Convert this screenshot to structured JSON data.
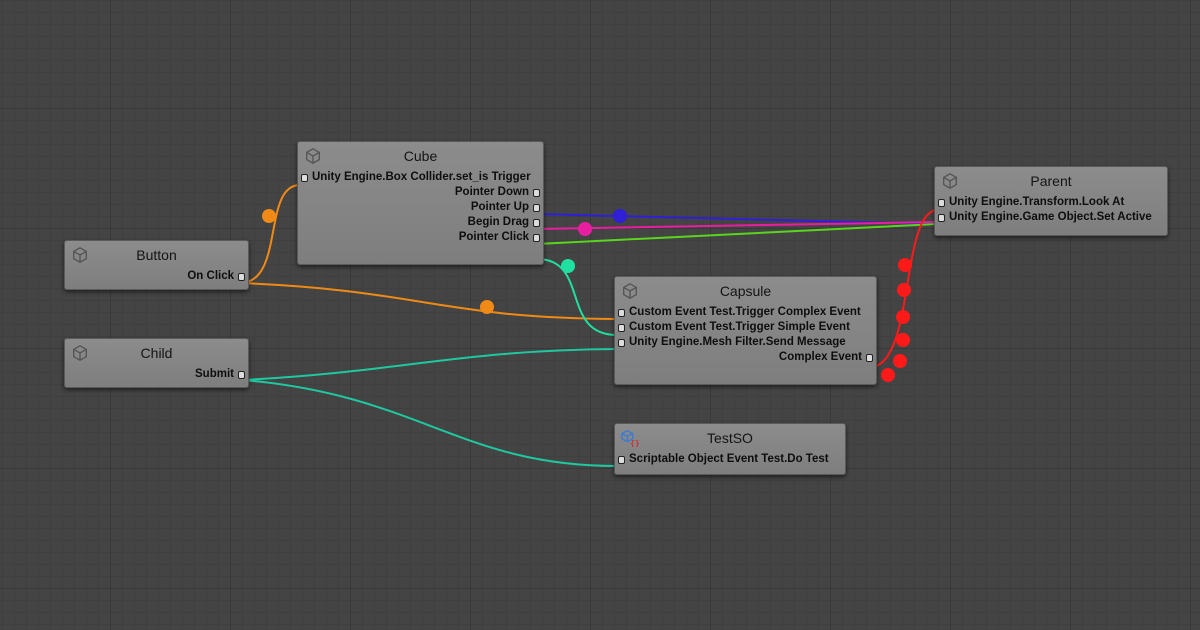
{
  "graph": {
    "nodes": {
      "cube": {
        "title": "Cube",
        "icon": "cube-icon",
        "inputs": [
          "Unity Engine.Box Collider.set_is Trigger"
        ],
        "outputs": [
          "Pointer Down",
          "Pointer Up",
          "Begin Drag",
          "Pointer Click"
        ]
      },
      "button": {
        "title": "Button",
        "icon": "cube-icon",
        "outputs": [
          "On Click"
        ]
      },
      "child": {
        "title": "Child",
        "icon": "cube-icon",
        "outputs": [
          "Submit"
        ]
      },
      "parent": {
        "title": "Parent",
        "icon": "cube-icon",
        "inputs": [
          "Unity Engine.Transform.Look At",
          "Unity Engine.Game Object.Set Active"
        ]
      },
      "capsule": {
        "title": "Capsule",
        "icon": "cube-icon",
        "inputs": [
          "Custom Event Test.Trigger Complex Event",
          "Custom Event Test.Trigger Simple Event",
          "Unity Engine.Mesh Filter.Send Message"
        ],
        "outputs": [
          "Complex Event"
        ]
      },
      "testso": {
        "title": "TestSO",
        "icon": "scriptable-object-icon",
        "inputs": [
          "Scriptable Object Event Test.Do Test"
        ]
      }
    },
    "connection_colors": {
      "button_on_click": "#f08a16",
      "cube_pointer_up": "#2f1fd6",
      "cube_begin_drag": "#e81ea0",
      "cube_pointer_click": "#5ad41e",
      "cube_pointer_down_capsule": "#1fe0a0",
      "child_submit": "#1fc8a0",
      "capsule_complex_event": "#ff1a1a"
    }
  }
}
